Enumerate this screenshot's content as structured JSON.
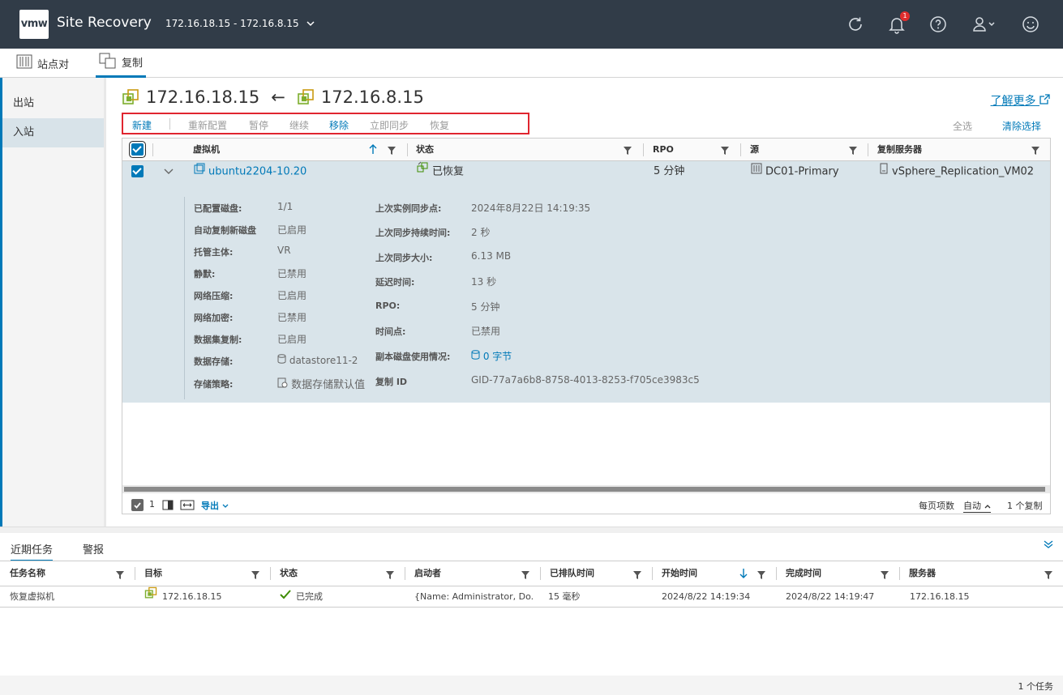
{
  "header": {
    "logo": "vmw",
    "app_title": "Site Recovery",
    "site_pair": "172.16.18.15 - 172.16.8.15",
    "notification_count": "1"
  },
  "main_tabs": [
    {
      "label": "站点对"
    },
    {
      "label": "复制"
    }
  ],
  "sidebar": {
    "items": [
      {
        "label": "出站"
      },
      {
        "label": "入站"
      }
    ]
  },
  "content": {
    "local_site": "172.16.18.15",
    "arrow": "←",
    "remote_site": "172.16.8.15",
    "learn_more": "了解更多"
  },
  "toolbar": {
    "new": "新建",
    "reconfigure": "重新配置",
    "pause": "暂停",
    "resume": "继续",
    "remove": "移除",
    "sync_now": "立即同步",
    "recover": "恢复",
    "select_all": "全选",
    "clear_selection": "清除选择"
  },
  "grid": {
    "columns": {
      "vm": "虚拟机",
      "status": "状态",
      "rpo": "RPO",
      "source": "源",
      "server": "复制服务器"
    },
    "row": {
      "vm": "ubuntu2204-10.20",
      "status": "已恢复",
      "rpo": "5 分钟",
      "source": "DC01-Primary",
      "server": "vSphere_Replication_VM02"
    },
    "details_left": [
      {
        "label": "已配置磁盘:",
        "value": "1/1"
      },
      {
        "label": "自动复制新磁盘",
        "value": "已启用"
      },
      {
        "label": "托管主体:",
        "value": "VR"
      },
      {
        "label": "静默:",
        "value": "已禁用"
      },
      {
        "label": "网络压缩:",
        "value": "已启用"
      },
      {
        "label": "网络加密:",
        "value": "已禁用"
      },
      {
        "label": "数据集复制:",
        "value": "已启用"
      },
      {
        "label": "数据存储:",
        "value": "datastore11-2"
      },
      {
        "label": "存储策略:",
        "value": "数据存储默认值"
      }
    ],
    "details_right": [
      {
        "label": "上次实例同步点:",
        "value": "2024年8月22日 14:19:35"
      },
      {
        "label": "上次同步持续时间:",
        "value": "2 秒"
      },
      {
        "label": "上次同步大小:",
        "value": "6.13 MB"
      },
      {
        "label": "延迟时间:",
        "value": "13 秒"
      },
      {
        "label": "RPO:",
        "value": "5 分钟"
      },
      {
        "label": "时间点:",
        "value": "已禁用"
      },
      {
        "label": "副本磁盘使用情况:",
        "value": "0 字节"
      },
      {
        "label": "复制 ID",
        "value": "GID-77a7a6b8-8758-4013-8253-f705ce3983c5"
      }
    ],
    "footer": {
      "selected_count": "1",
      "export": "导出",
      "page_size_label": "每页项数",
      "page_size_value": "自动",
      "total": "1 个复制"
    }
  },
  "bottom": {
    "tabs": [
      {
        "label": "近期任务"
      },
      {
        "label": "警报"
      }
    ],
    "columns": [
      "任务名称",
      "目标",
      "状态",
      "启动者",
      "已排队时间",
      "开始时间",
      "完成时间",
      "服务器"
    ],
    "rows": [
      {
        "task": "恢复虚拟机",
        "target": "172.16.18.15",
        "status": "已完成",
        "initiator": "{Name: Administrator, Do...",
        "queued": "15 毫秒",
        "start": "2024/8/22 14:19:34",
        "end": "2024/8/22 14:19:47",
        "server": "172.16.18.15"
      }
    ],
    "footer": "1 个任务"
  },
  "colors": {
    "header_bg": "#313c48",
    "accent": "#0079b8",
    "selected_row": "#d9e4ea",
    "highlight_box": "#e0252f",
    "success": "#3d8c00"
  }
}
